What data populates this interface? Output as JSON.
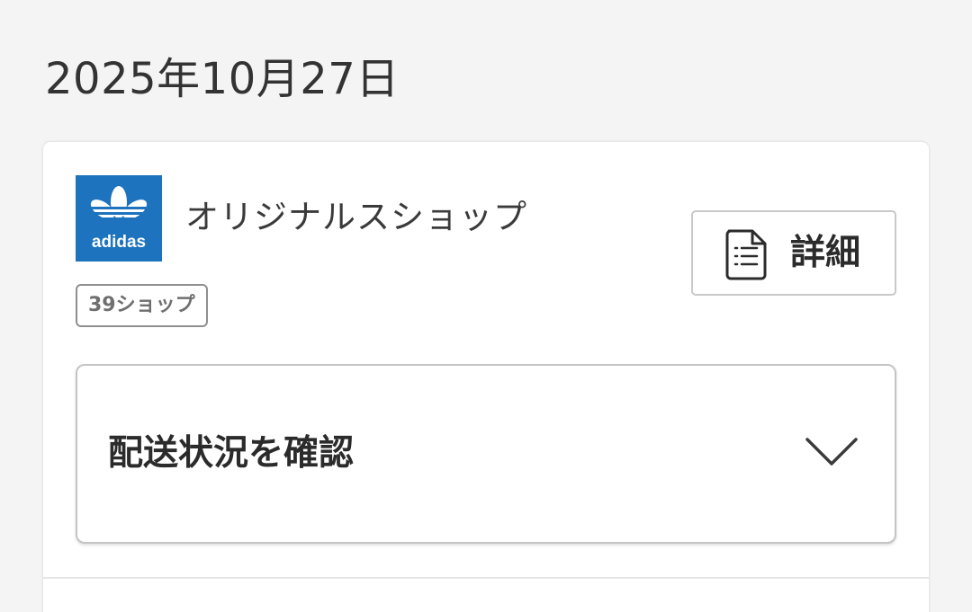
{
  "date_heading": "2025年10月27日",
  "order": {
    "shop_logo": {
      "icon": "adidas-trefoil-logo",
      "brand_text": "adidas",
      "background_color": "#1e73be"
    },
    "shop_name": "オリジナルスショップ",
    "shop_badge": "39ショップ",
    "details_button": {
      "icon": "document-list-icon",
      "label": "詳細"
    },
    "delivery_status": {
      "label": "配送状況を確認",
      "icon": "chevron-down-icon"
    }
  }
}
